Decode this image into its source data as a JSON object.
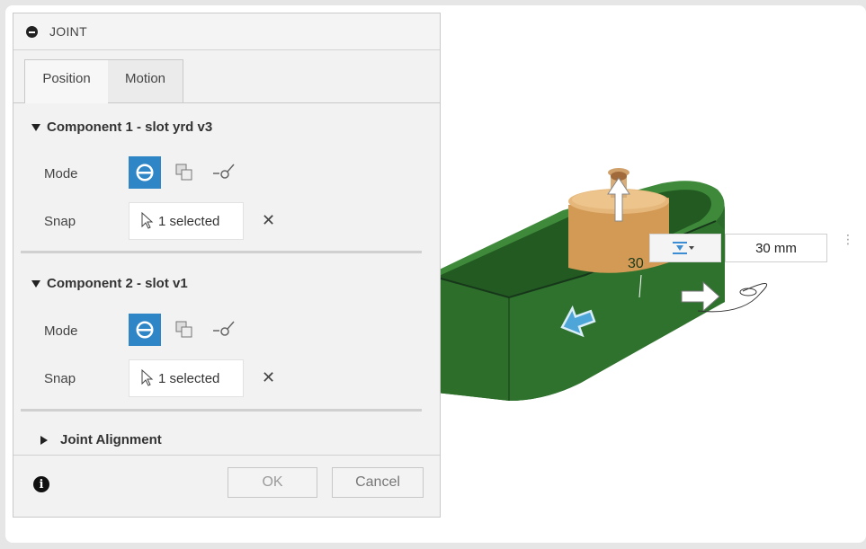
{
  "dialog": {
    "title": "JOINT",
    "tabs": [
      {
        "label": "Position",
        "active": true
      },
      {
        "label": "Motion",
        "active": false
      }
    ],
    "component1": {
      "title": "Component 1 - slot yrd v3",
      "mode_label": "Mode",
      "snap_label": "Snap",
      "snap_value": "1 selected"
    },
    "component2": {
      "title": "Component 2 - slot v1",
      "mode_label": "Mode",
      "snap_label": "Snap",
      "snap_value": "1 selected"
    },
    "joint_alignment": {
      "title": "Joint Alignment",
      "expanded": false
    },
    "footer": {
      "ok_label": "OK",
      "cancel_label": "Cancel"
    }
  },
  "manipulator": {
    "value": "30 mm",
    "dimension_text": "30",
    "icon": "distance-icon"
  },
  "colors": {
    "accent": "#2f86c7",
    "body_green": "#2e6b2c",
    "cylinder_orange": "#d9a45f",
    "arrow_blue": "#4ea6d8"
  }
}
